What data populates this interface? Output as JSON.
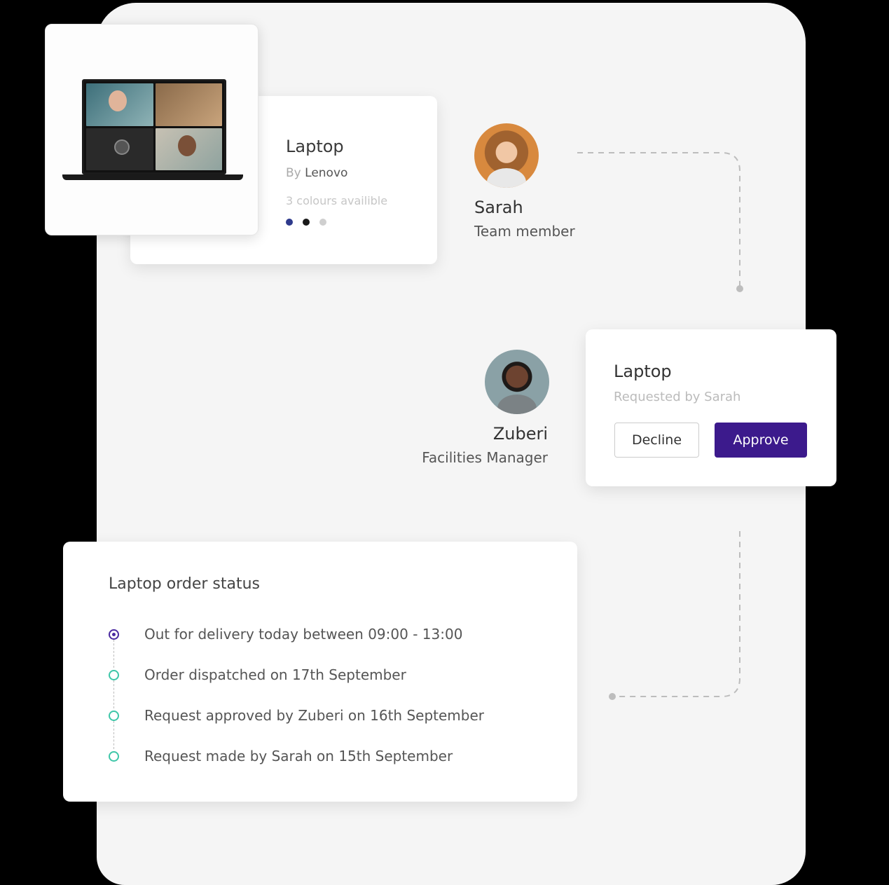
{
  "product": {
    "title": "Laptop",
    "by_prefix": "By",
    "brand": "Lenovo",
    "colors_note": "3 colours availible",
    "color_swatches": [
      "#2e3a8c",
      "#1a1a1a",
      "#cfcfcf"
    ]
  },
  "requester": {
    "name": "Sarah",
    "role": "Team member"
  },
  "approver": {
    "name": "Zuberi",
    "role": "Facilities Manager"
  },
  "approval": {
    "title": "Laptop",
    "subtitle": "Requested by Sarah",
    "decline_label": "Decline",
    "approve_label": "Approve",
    "accent_color": "#3c1a8c"
  },
  "order_status": {
    "title": "Laptop order status",
    "steps": [
      {
        "label": "Out for delivery today between 09:00 - 13:00",
        "current": true
      },
      {
        "label": "Order dispatched on 17th September",
        "current": false
      },
      {
        "label": "Request approved by Zuberi on 16th September",
        "current": false
      },
      {
        "label": "Request made by Sarah on 15th September",
        "current": false
      }
    ],
    "step_color": "#3ec6a8",
    "current_color": "#4a2aa0"
  }
}
